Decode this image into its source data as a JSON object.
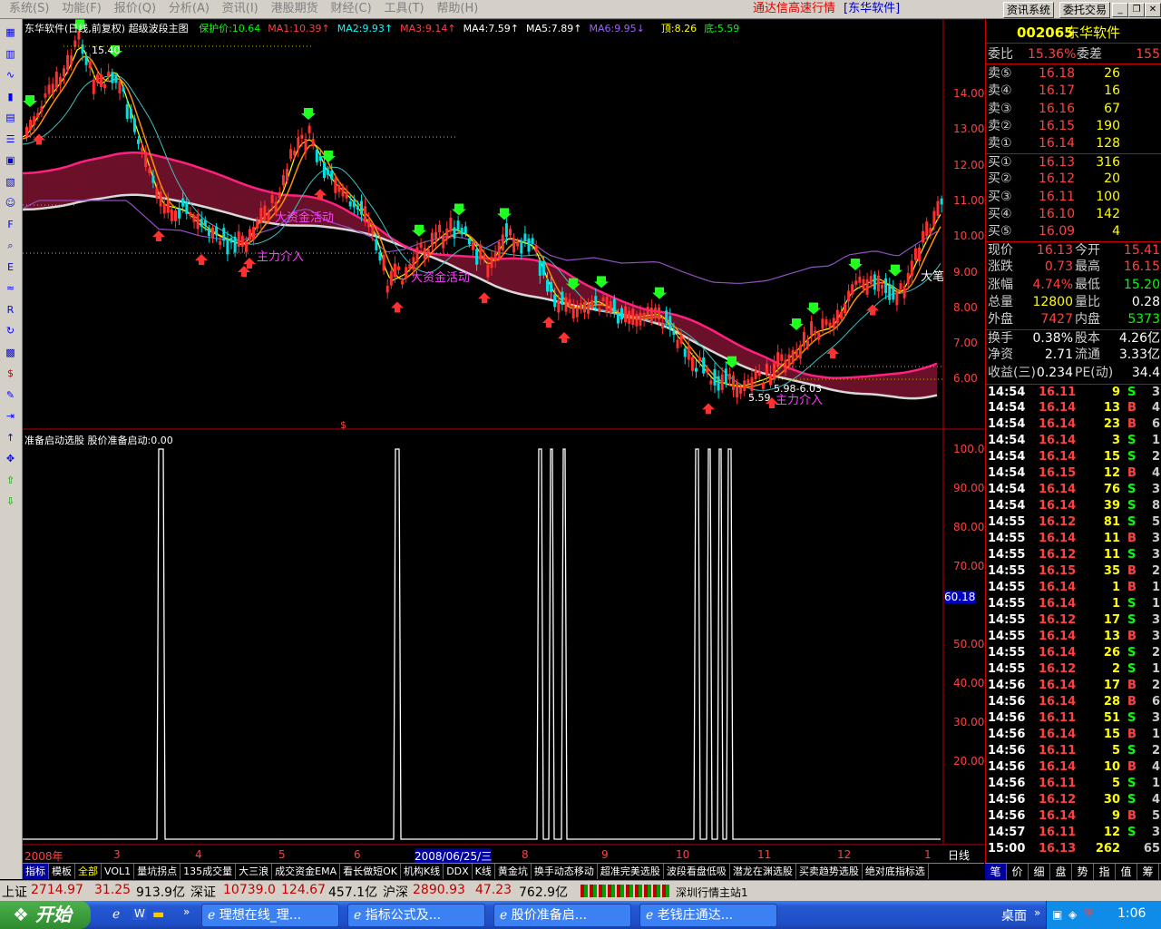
{
  "menu": {
    "items": [
      "系统(S)",
      "功能(F)",
      "报价(Q)",
      "分析(A)",
      "资讯(I)",
      "港股期货",
      "财经(C)",
      "工具(T)",
      "帮助(H)"
    ],
    "promo": "通达信高速行情",
    "app_name": "[东华软件]",
    "btn_news": "资讯系统",
    "btn_trade": "委托交易"
  },
  "left_toolbar": {
    "icons": [
      "grid-icon",
      "kline-icon",
      "line-icon",
      "bar-icon",
      "table-icon",
      "list-icon",
      "news-icon",
      "calendar-icon",
      "people-icon",
      "f10-icon",
      "search-icon",
      "etf-icon",
      "wave-icon",
      "rsi-icon",
      "refresh-icon",
      "calc-icon",
      "dollar-icon",
      "wrench-icon",
      "export-icon",
      "up-arrow-icon",
      "move-icon",
      "up-green-icon",
      "down-green-icon"
    ]
  },
  "chart": {
    "header_title": "东华软件(日线,前复权) 超级波段主图",
    "ma_labels": [
      {
        "text": "保护价:10.64",
        "color": "#00ff00"
      },
      {
        "text": "MA1:10.39↑",
        "color": "#ff4040"
      },
      {
        "text": "MA2:9.93↑",
        "color": "#00ffff"
      },
      {
        "text": "MA3:9.14↑",
        "color": "#ff4040"
      },
      {
        "text": "MA4:7.59↑",
        "color": "#ffffff"
      },
      {
        "text": "MA5:7.89↑",
        "color": "#ffffff"
      },
      {
        "text": "MA6:9.95↓",
        "color": "#a060ff"
      },
      {
        "text": "顶:8.26",
        "color": "#ffff00"
      },
      {
        "text": "底:5.59",
        "color": "#00ff00"
      }
    ],
    "annotations": {
      "high_label": "15.40",
      "low_label": "5.59",
      "range_label": "5.98-6.03",
      "big_funds_1": "大资金活动",
      "main_force_1": "主力介入",
      "big_funds_2": "大资金活动",
      "main_force_2": "主力介入",
      "right_label": "大笔"
    },
    "price_axis": [
      "14.00",
      "13.00",
      "12.00",
      "11.00",
      "10.00",
      "9.00",
      "8.00",
      "7.00",
      "6.00"
    ],
    "indicator_title": "准备启动选股  股价准备启动:0.00",
    "indicator_axis": [
      "100.0",
      "90.00",
      "80.00",
      "70.00",
      "60.18",
      "50.00",
      "40.00",
      "30.00",
      "20.00"
    ],
    "indicator_marker": "60.18",
    "date_axis": [
      "2008年",
      "3",
      "4",
      "5",
      "6",
      "2008/06/25/三",
      "8",
      "9",
      "10",
      "11",
      "12",
      "1"
    ],
    "period_label": "日线"
  },
  "indicator_tabs": [
    "指标",
    "模板",
    "全部",
    "VOL1",
    "量坑拐点",
    "135成交量",
    "大三浪",
    "成交资金EMA",
    "看长做短OK",
    "机构K线",
    "DDX",
    "K线",
    "黄金坑",
    "换手动态移动",
    "超准完美选股",
    "波段看盘低吸",
    "潜龙在渊选股",
    "买卖趋势选股",
    "绝对底指标选"
  ],
  "quote": {
    "code": "002065",
    "name": "东华软件",
    "weibi_label": "委比",
    "weibi_value": "15.36%",
    "weicha_label": "委差",
    "weicha_value": "155",
    "asks": [
      {
        "label": "卖⑤",
        "price": "16.18",
        "vol": "26"
      },
      {
        "label": "卖④",
        "price": "16.17",
        "vol": "16"
      },
      {
        "label": "卖③",
        "price": "16.16",
        "vol": "67"
      },
      {
        "label": "卖②",
        "price": "16.15",
        "vol": "190"
      },
      {
        "label": "卖①",
        "price": "16.14",
        "vol": "128"
      }
    ],
    "bids": [
      {
        "label": "买①",
        "price": "16.13",
        "vol": "316"
      },
      {
        "label": "买②",
        "price": "16.12",
        "vol": "20"
      },
      {
        "label": "买③",
        "price": "16.11",
        "vol": "100"
      },
      {
        "label": "买④",
        "price": "16.10",
        "vol": "142"
      },
      {
        "label": "买⑤",
        "price": "16.09",
        "vol": "4"
      }
    ],
    "stats": [
      {
        "l1": "现价",
        "v1": "16.13",
        "c1": "#ff4040",
        "l2": "今开",
        "v2": "15.41",
        "c2": "#ff4040"
      },
      {
        "l1": "涨跌",
        "v1": "0.73",
        "c1": "#ff4040",
        "l2": "最高",
        "v2": "16.15",
        "c2": "#ff4040"
      },
      {
        "l1": "涨幅",
        "v1": "4.74%",
        "c1": "#ff4040",
        "l2": "最低",
        "v2": "15.20",
        "c2": "#00ff00"
      },
      {
        "l1": "总量",
        "v1": "12800",
        "c1": "#ffff00",
        "l2": "量比",
        "v2": "0.28",
        "c2": "#ffffff"
      },
      {
        "l1": "外盘",
        "v1": "7427",
        "c1": "#ff4040",
        "l2": "内盘",
        "v2": "5373",
        "c2": "#00ff00"
      }
    ],
    "stats2": [
      {
        "l1": "换手",
        "v1": "0.38%",
        "l2": "股本",
        "v2": "4.26亿"
      },
      {
        "l1": "净资",
        "v1": "2.71",
        "l2": "流通",
        "v2": "3.33亿"
      },
      {
        "l1": "收益(三)",
        "v1": "0.234",
        "l2": "PE(动)",
        "v2": "34.4"
      }
    ],
    "ticks": [
      {
        "t": "14:54",
        "p": "16.11",
        "v": "9",
        "s": "S",
        "n": "3"
      },
      {
        "t": "14:54",
        "p": "16.14",
        "v": "13",
        "s": "B",
        "n": "4"
      },
      {
        "t": "14:54",
        "p": "16.14",
        "v": "23",
        "s": "B",
        "n": "6"
      },
      {
        "t": "14:54",
        "p": "16.14",
        "v": "3",
        "s": "S",
        "n": "1"
      },
      {
        "t": "14:54",
        "p": "16.14",
        "v": "15",
        "s": "S",
        "n": "2"
      },
      {
        "t": "14:54",
        "p": "16.15",
        "v": "12",
        "s": "B",
        "n": "4"
      },
      {
        "t": "14:54",
        "p": "16.14",
        "v": "76",
        "s": "S",
        "n": "3"
      },
      {
        "t": "14:54",
        "p": "16.14",
        "v": "39",
        "s": "S",
        "n": "8"
      },
      {
        "t": "14:55",
        "p": "16.12",
        "v": "81",
        "s": "S",
        "n": "5"
      },
      {
        "t": "14:55",
        "p": "16.14",
        "v": "11",
        "s": "B",
        "n": "3"
      },
      {
        "t": "14:55",
        "p": "16.12",
        "v": "11",
        "s": "S",
        "n": "3"
      },
      {
        "t": "14:55",
        "p": "16.15",
        "v": "35",
        "s": "B",
        "n": "2"
      },
      {
        "t": "14:55",
        "p": "16.14",
        "v": "1",
        "s": "B",
        "n": "1"
      },
      {
        "t": "14:55",
        "p": "16.14",
        "v": "1",
        "s": "S",
        "n": "1"
      },
      {
        "t": "14:55",
        "p": "16.12",
        "v": "17",
        "s": "S",
        "n": "3"
      },
      {
        "t": "14:55",
        "p": "16.14",
        "v": "13",
        "s": "B",
        "n": "3"
      },
      {
        "t": "14:55",
        "p": "16.14",
        "v": "26",
        "s": "S",
        "n": "2"
      },
      {
        "t": "14:55",
        "p": "16.12",
        "v": "2",
        "s": "S",
        "n": "1"
      },
      {
        "t": "14:56",
        "p": "16.14",
        "v": "17",
        "s": "B",
        "n": "2"
      },
      {
        "t": "14:56",
        "p": "16.14",
        "v": "28",
        "s": "B",
        "n": "6"
      },
      {
        "t": "14:56",
        "p": "16.11",
        "v": "51",
        "s": "S",
        "n": "3"
      },
      {
        "t": "14:56",
        "p": "16.14",
        "v": "15",
        "s": "B",
        "n": "1"
      },
      {
        "t": "14:56",
        "p": "16.11",
        "v": "5",
        "s": "S",
        "n": "2"
      },
      {
        "t": "14:56",
        "p": "16.14",
        "v": "10",
        "s": "B",
        "n": "4"
      },
      {
        "t": "14:56",
        "p": "16.11",
        "v": "5",
        "s": "S",
        "n": "1"
      },
      {
        "t": "14:56",
        "p": "16.12",
        "v": "30",
        "s": "S",
        "n": "4"
      },
      {
        "t": "14:56",
        "p": "16.14",
        "v": "9",
        "s": "B",
        "n": "5"
      },
      {
        "t": "14:57",
        "p": "16.11",
        "v": "12",
        "s": "S",
        "n": "3"
      },
      {
        "t": "15:00",
        "p": "16.13",
        "v": "262",
        "s": "",
        "n": "65"
      }
    ]
  },
  "right_tabs": [
    "笔",
    "价",
    "细",
    "盘",
    "势",
    "指",
    "值",
    "筹"
  ],
  "status_bar": {
    "sh_label": "上证",
    "sh_value": "2714.97",
    "sh_change": "31.25",
    "sh_amount": "913.9亿",
    "sz_label": "深证",
    "sz_value": "10739.0",
    "sz_change": "124.67",
    "sz_amount": "457.1亿",
    "hs_label": "沪深",
    "hs_value": "2890.93",
    "hs_change": "47.23",
    "hs_amount": "762.9亿",
    "server": "深圳行情主站1"
  },
  "taskbar": {
    "start": "开始",
    "tasks": [
      "理想在线_理...",
      "指标公式及...",
      "股价准备启...",
      "老钱庄通达..."
    ],
    "desktop": "桌面",
    "clock": "1:06"
  },
  "colors": {
    "up": "#ff4040",
    "down": "#00ffff",
    "green": "#00ff00",
    "yellow": "#ffff00",
    "grid": "#c00000"
  }
}
